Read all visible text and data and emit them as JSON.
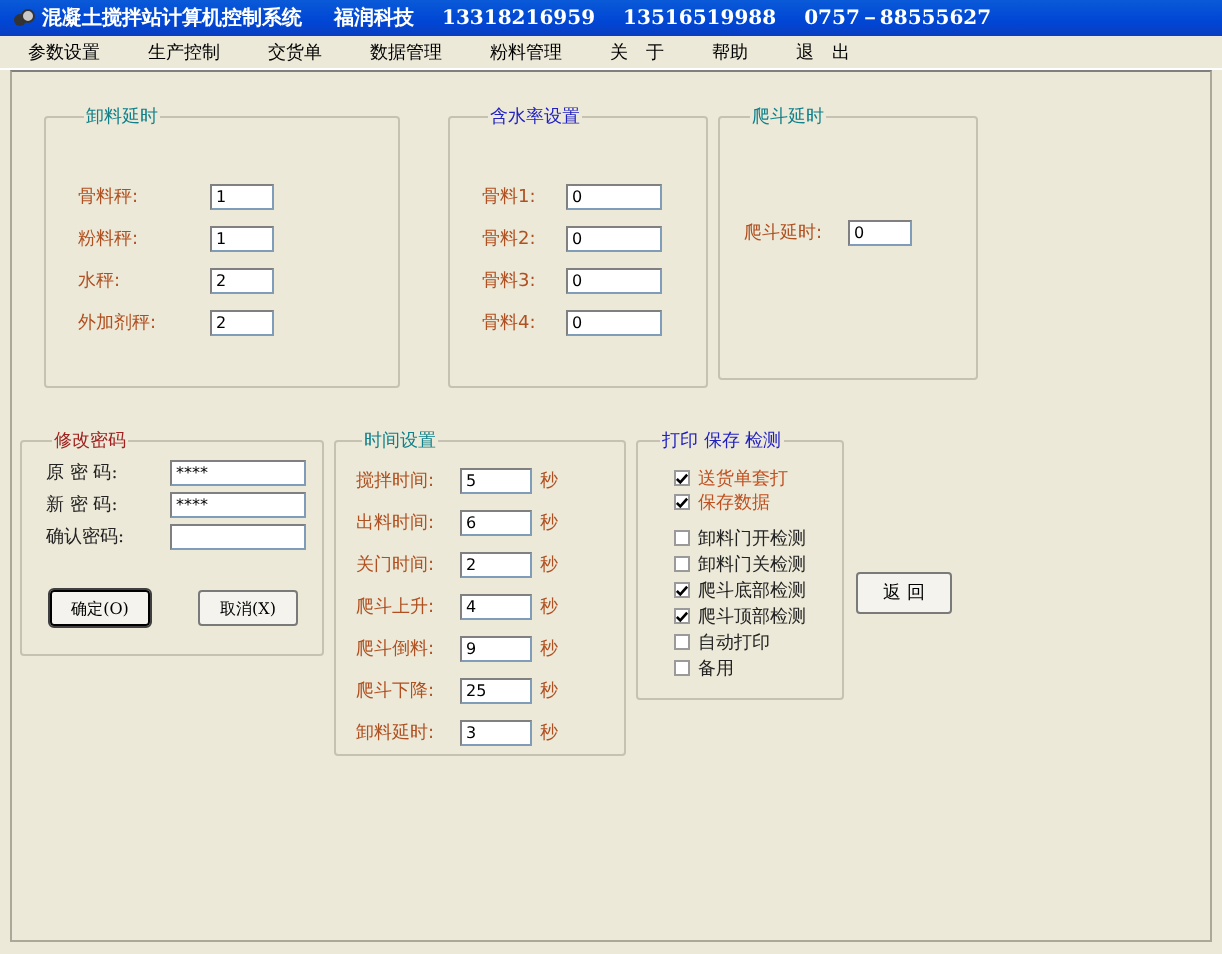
{
  "window": {
    "title": "混凝土搅拌站计算机控制系统",
    "company": "福润科技",
    "phones": [
      "13318216959",
      "13516519988",
      "0757－88555627"
    ]
  },
  "menu": [
    "参数设置",
    "生产控制",
    "交货单",
    "数据管理",
    "粉料管理",
    "关　于",
    "帮助",
    "退　出"
  ],
  "discharge_delay": {
    "title": "卸料延时",
    "fields": [
      {
        "label": "骨料秤:",
        "value": "1"
      },
      {
        "label": "粉料秤:",
        "value": "1"
      },
      {
        "label": "水秤:",
        "value": "2"
      },
      {
        "label": "外加剂秤:",
        "value": "2"
      }
    ]
  },
  "moisture": {
    "title": "含水率设置",
    "fields": [
      {
        "label": "骨料1:",
        "value": "0"
      },
      {
        "label": "骨料2:",
        "value": "0"
      },
      {
        "label": "骨料3:",
        "value": "0"
      },
      {
        "label": "骨料4:",
        "value": "0"
      }
    ]
  },
  "hopper_delay": {
    "title": "爬斗延时",
    "fields": [
      {
        "label": "爬斗延时:",
        "value": "0"
      }
    ]
  },
  "password": {
    "title": "修改密码",
    "fields": [
      {
        "label": "原 密 码:",
        "value": "****"
      },
      {
        "label": "新 密 码:",
        "value": "****"
      },
      {
        "label": "确认密码:"
      }
    ],
    "buttons": [
      "确定(O)",
      "取消(X)"
    ]
  },
  "time_settings": {
    "title": "时间设置",
    "fields": [
      {
        "label": "搅拌时间:",
        "value": "5",
        "unit": "秒"
      },
      {
        "label": "出料时间:",
        "value": "6",
        "unit": "秒"
      },
      {
        "label": "关门时间:",
        "value": "2",
        "unit": "秒"
      },
      {
        "label": "爬斗上升:",
        "value": "4",
        "unit": "秒"
      },
      {
        "label": "爬斗倒料:",
        "value": "9",
        "unit": "秒"
      },
      {
        "label": "爬斗下降:",
        "value": "25",
        "unit": "秒"
      },
      {
        "label": "卸料延时:",
        "value": "3",
        "unit": "秒"
      }
    ]
  },
  "print_save_detect": {
    "title": "打印 保存 检测",
    "options": [
      {
        "label": "送货单套打",
        "checked": true,
        "kind": "output"
      },
      {
        "label": "保存数据",
        "checked": true,
        "kind": "output"
      },
      {
        "label": "卸料门开检测",
        "checked": false,
        "kind": "detect"
      },
      {
        "label": "卸料门关检测",
        "checked": false,
        "kind": "detect"
      },
      {
        "label": "爬斗底部检测",
        "checked": true,
        "kind": "detect"
      },
      {
        "label": "爬斗顶部检测",
        "checked": true,
        "kind": "detect"
      },
      {
        "label": "自动打印",
        "checked": false,
        "kind": "detect"
      },
      {
        "label": "备用",
        "checked": false,
        "kind": "detect"
      }
    ]
  },
  "return_button": "返 回"
}
